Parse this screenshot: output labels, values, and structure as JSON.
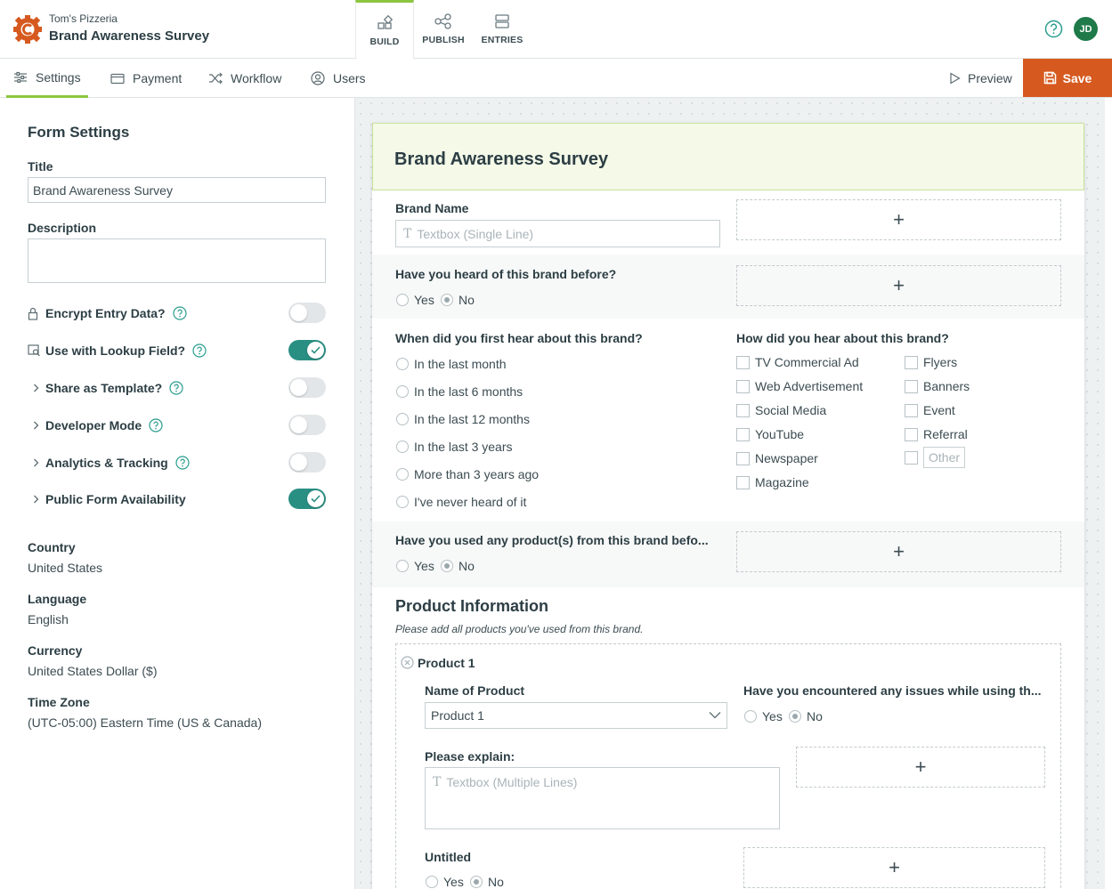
{
  "header": {
    "org": "Tom's Pizzeria",
    "form_title": "Brand Awareness Survey",
    "modes": [
      "BUILD",
      "PUBLISH",
      "ENTRIES"
    ],
    "avatar_initials": "JD",
    "accent_color": "#8cc63f",
    "brand_color": "#d65a1f"
  },
  "subnav": {
    "tabs": [
      "Settings",
      "Payment",
      "Workflow",
      "Users"
    ],
    "preview": "Preview",
    "save": "Save"
  },
  "settings": {
    "heading": "Form Settings",
    "title_label": "Title",
    "title_value": "Brand Awareness Survey",
    "description_label": "Description",
    "toggles": [
      {
        "label": "Encrypt Entry Data?",
        "on": false
      },
      {
        "label": "Use with Lookup Field?",
        "on": true
      },
      {
        "label": "Share as Template?",
        "on": false
      },
      {
        "label": "Developer Mode",
        "on": false
      },
      {
        "label": "Analytics & Tracking",
        "on": false
      },
      {
        "label": "Public Form Availability",
        "on": true
      }
    ],
    "country_label": "Country",
    "country_value": "United States",
    "language_label": "Language",
    "language_value": "English",
    "currency_label": "Currency",
    "currency_value": "United States Dollar ($)",
    "timezone_label": "Time Zone",
    "timezone_value": "(UTC-05:00) Eastern Time (US & Canada)"
  },
  "form": {
    "title": "Brand Awareness Survey",
    "brand_name_label": "Brand Name",
    "brand_name_placeholder": "Textbox (Single Line)",
    "heard_label": "Have you heard of this brand before?",
    "yes": "Yes",
    "no": "No",
    "when_label": "When did you first hear about this brand?",
    "when_options": [
      "In the last month",
      "In the last 6 months",
      "In the last 12 months",
      "In the last 3 years",
      "More than 3 years ago",
      "I've never heard of it"
    ],
    "how_label": "How did you hear about this brand?",
    "how_options_left": [
      "TV Commercial Ad",
      "Web Advertisement",
      "Social Media",
      "YouTube",
      "Newspaper",
      "Magazine"
    ],
    "how_options_right": [
      "Flyers",
      "Banners",
      "Event",
      "Referral"
    ],
    "how_other": "Other",
    "used_label": "Have you used any product(s) from this brand befo...",
    "section_title": "Product Information",
    "section_desc": "Please add all products you've used from this brand.",
    "product_item": "Product 1",
    "name_of_product_label": "Name of Product",
    "name_of_product_value": "Product 1",
    "issues_label": "Have you encountered any issues while using th...",
    "explain_label": "Please explain:",
    "explain_placeholder": "Textbox (Multiple Lines)",
    "untitled_label": "Untitled",
    "add_symbol": "+"
  }
}
